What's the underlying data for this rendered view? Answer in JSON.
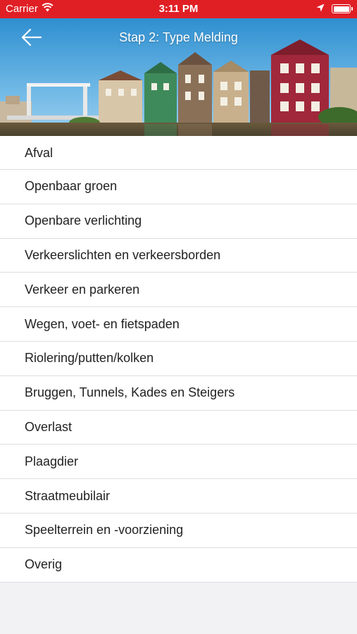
{
  "status_bar": {
    "carrier": "Carrier",
    "time": "3:11 PM",
    "icons": [
      "wifi-icon",
      "location-icon",
      "battery-icon"
    ]
  },
  "header": {
    "title": "Stap 2: Type Melding",
    "back_icon": "arrow-left-icon",
    "background": "canal-houses-photo"
  },
  "colors": {
    "status_bar": "#e01f25",
    "list_background": "#ffffff",
    "page_background": "#f2f2f4",
    "divider": "#dedee2"
  },
  "categories": [
    {
      "label": "Afval"
    },
    {
      "label": "Openbaar groen"
    },
    {
      "label": "Openbare verlichting"
    },
    {
      "label": "Verkeerslichten en verkeersborden"
    },
    {
      "label": "Verkeer en parkeren"
    },
    {
      "label": "Wegen, voet- en fietspaden"
    },
    {
      "label": "Riolering/putten/kolken"
    },
    {
      "label": "Bruggen, Tunnels, Kades en Steigers"
    },
    {
      "label": "Overlast"
    },
    {
      "label": "Plaagdier"
    },
    {
      "label": "Straatmeubilair"
    },
    {
      "label": "Speelterrein en -voorziening"
    },
    {
      "label": "Overig"
    }
  ]
}
